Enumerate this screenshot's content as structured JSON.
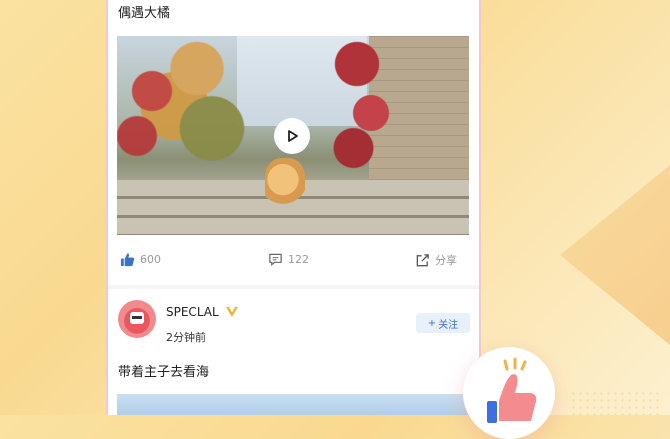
{
  "feed": {
    "post1": {
      "title": "偶遇大橘",
      "likes": "600",
      "comments": "122",
      "share_label": "分享"
    },
    "post2": {
      "author": "SPECLAL",
      "time": "2分钟前",
      "follow_label": "关注",
      "text": "带着主子去看海"
    }
  },
  "colors": {
    "accent_blue": "#3c73c6",
    "phone_border": "#f4c8cf",
    "badge_gold": "#e8b730"
  },
  "icons": [
    "play-icon",
    "thumb-up-icon",
    "comment-icon",
    "share-icon",
    "verified-v-icon",
    "plus-icon",
    "like-hand-icon"
  ]
}
